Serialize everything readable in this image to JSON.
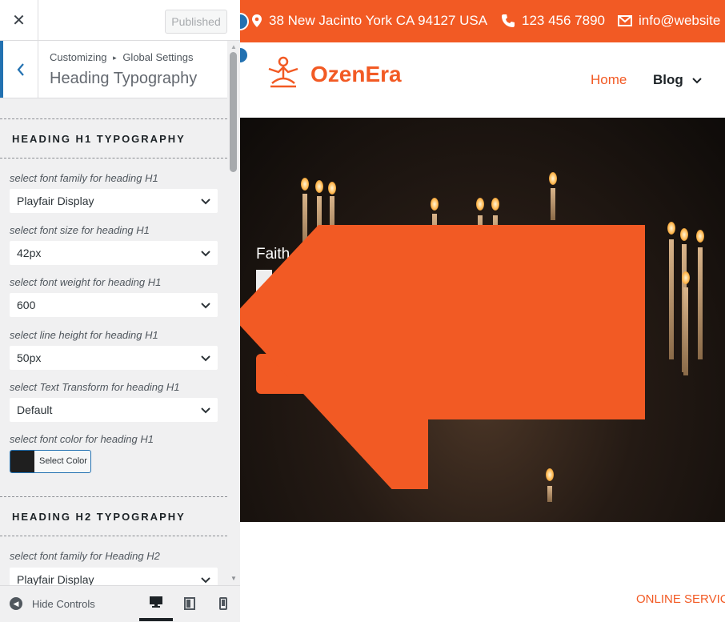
{
  "header": {
    "close_symbol": "✕",
    "publish_label": "Published"
  },
  "section": {
    "back_symbol": "‹",
    "breadcrumb_root": "Customizing",
    "breadcrumb_sep": "▸",
    "breadcrumb_parent": "Global Settings",
    "title": "Heading Typography"
  },
  "h1": {
    "heading": "HEADING H1 TYPOGRAPHY",
    "controls": [
      {
        "label": "select font family for heading H1",
        "value": "Playfair Display"
      },
      {
        "label": "select font size for heading H1",
        "value": "42px"
      },
      {
        "label": "select font weight for heading H1",
        "value": "600"
      },
      {
        "label": "select line height for heading H1",
        "value": "50px"
      },
      {
        "label": "select Text Transform for heading H1",
        "value": "Default"
      }
    ],
    "color_label": "select font color for heading H1",
    "color_button": "Select Color",
    "color_value": "#1f1f1f"
  },
  "h2": {
    "heading": "HEADING H2 TYPOGRAPHY",
    "controls": [
      {
        "label": "select font family for Heading H2",
        "value": "Playfair Display"
      }
    ]
  },
  "footer": {
    "hide_controls": "Hide Controls"
  },
  "preview": {
    "address": "38 New Jacinto York CA 94127 USA",
    "phone": "123 456 7890",
    "email": "info@website",
    "brand": "OzenEra",
    "nav_home": "Home",
    "nav_blog": "Blog",
    "hero_text": "Faith",
    "online": "ONLINE SERVIC"
  },
  "colors": {
    "accent": "#f25a24",
    "wp_blue": "#2271b1"
  }
}
